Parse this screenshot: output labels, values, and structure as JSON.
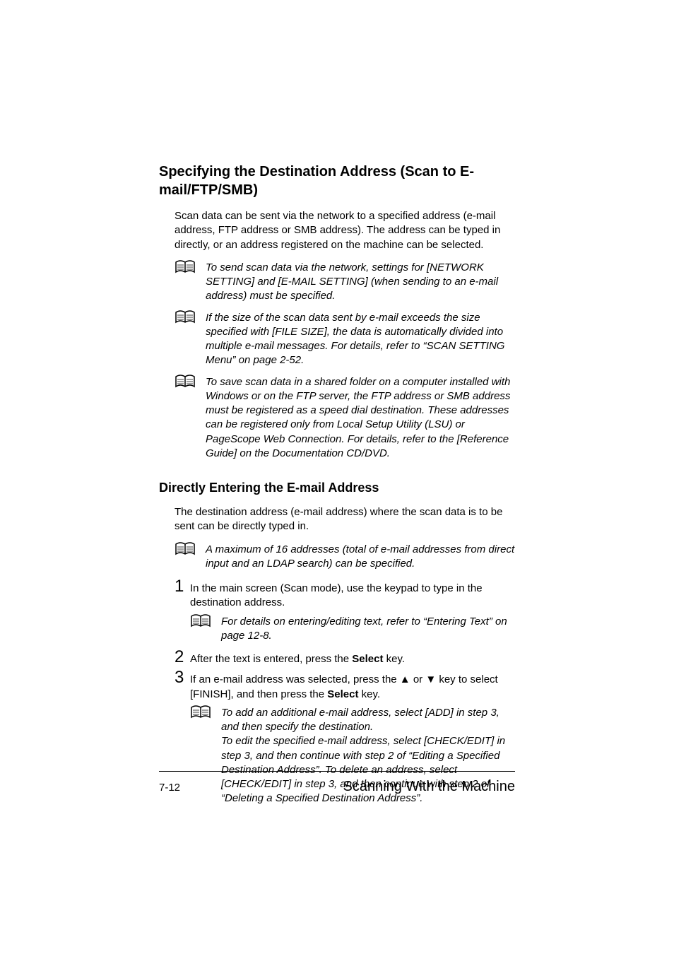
{
  "heading1": "Specifying the Destination Address (Scan to E-mail/FTP/SMB)",
  "intro": "Scan data can be sent via the network to a specified address (e-mail address, FTP address or SMB address). The address can be typed in directly, or an address registered on the machine can be selected.",
  "note1": "To send scan data via the network, settings for [NETWORK SETTING] and [E-MAIL SETTING] (when sending to an e-mail address) must be specified.",
  "note2": "If the size of the scan data sent by e-mail exceeds the size specified with [FILE SIZE], the data is automatically divided into multiple e-mail messages. For details, refer to “SCAN SETTING Menu” on page 2-52.",
  "note3": "To save scan data in a shared folder on a computer installed with Windows or on the FTP server, the FTP address or SMB address must be registered as a speed dial destination. These addresses can be registered only from Local Setup Utility (LSU) or PageScope Web Connection. For details, refer to the [Reference Guide] on the Documentation CD/DVD.",
  "heading2": "Directly Entering the E-mail Address",
  "intro2": "The destination address (e-mail address) where the scan data is to be sent can be directly typed in.",
  "note4": "A maximum of 16 addresses (total of e-mail addresses from direct input and an LDAP search) can be specified.",
  "step1_num": "1",
  "step1_text": "In the main screen (Scan mode), use the keypad to type in the destination address.",
  "step1_note": "For details on entering/editing text, refer to “Entering Text” on page 12-8.",
  "step2_num": "2",
  "step2_pre": "After the text is entered, press the ",
  "step2_bold": "Select",
  "step2_post": " key.",
  "step3_num": "3",
  "step3_pre": "If an e-mail address was selected, press the ▲ or ▼ key to select [FINISH], and then press the ",
  "step3_bold": "Select",
  "step3_post": " key.",
  "step3_note": "To add an additional e-mail address, select [ADD] in step 3, and then specify the destination.\nTo edit the specified e-mail address, select [CHECK/EDIT] in step 3, and then continue with step 2 of “Editing a Specified Destination Address”. To delete an address, select [CHECK/EDIT] in step 3, and then continue with step 2 of “Deleting a Specified Destination Address”.",
  "footer_left": "7-12",
  "footer_right": "Scanning With the Machine"
}
